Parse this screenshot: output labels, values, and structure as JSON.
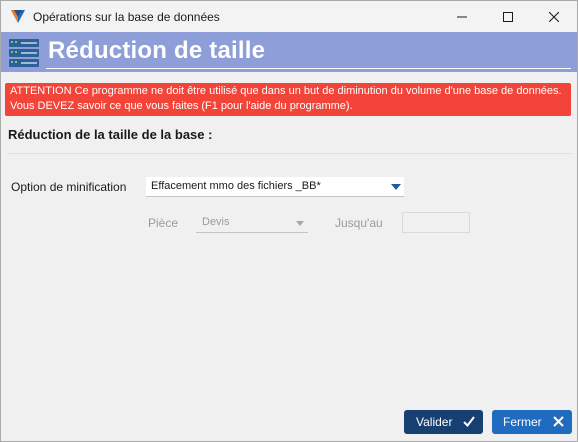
{
  "window": {
    "title": "Opérations sur la base de données",
    "accent_color": "#1e6bbf"
  },
  "banner": {
    "title": "Réduction de taille",
    "icon": "server-rack-icon",
    "color": "#8d9ed8"
  },
  "warning": {
    "text": "ATTENTION Ce programme ne doit être utilisé que dans un but de diminution du volume d'une base de données. Vous DEVEZ savoir ce que vous faites (F1 pour l'aide du programme).",
    "color": "#f24438"
  },
  "section": {
    "title": "Réduction de la taille de la base :"
  },
  "form": {
    "option_label": "Option de minification",
    "option_value": "Effacement mmo des fichiers _BB*",
    "piece_label": "Pièce",
    "piece_value": "Devis",
    "jusquau_label": "Jusqu'au",
    "jusquau_value": ""
  },
  "buttons": {
    "valider": "Valider",
    "fermer": "Fermer"
  }
}
